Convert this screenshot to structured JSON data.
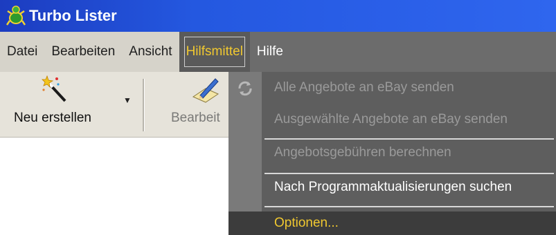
{
  "window": {
    "title": "Turbo Lister"
  },
  "menubar": {
    "items": [
      {
        "label": "Datei"
      },
      {
        "label": "Bearbeiten"
      },
      {
        "label": "Ansicht"
      },
      {
        "label": "Hilfsmittel"
      },
      {
        "label": "Hilfe"
      }
    ]
  },
  "toolbar": {
    "new_label": "Neu erstellen",
    "edit_label": "Bearbeit"
  },
  "dropdown": {
    "items": [
      {
        "label": "Alle Angebote an eBay senden",
        "enabled": false
      },
      {
        "label": "Ausgewählte Angebote an eBay senden",
        "enabled": false
      },
      {
        "label": "Angebotsgebühren berechnen",
        "enabled": false
      },
      {
        "label": "Nach Programmaktualisierungen suchen",
        "enabled": true
      },
      {
        "label": "Optionen...",
        "enabled": true,
        "highlighted": true
      }
    ]
  },
  "colors": {
    "titlebar": "#2458e0",
    "menu_highlight_text": "#f0c830",
    "dropdown_bg": "#5e5e5e"
  }
}
